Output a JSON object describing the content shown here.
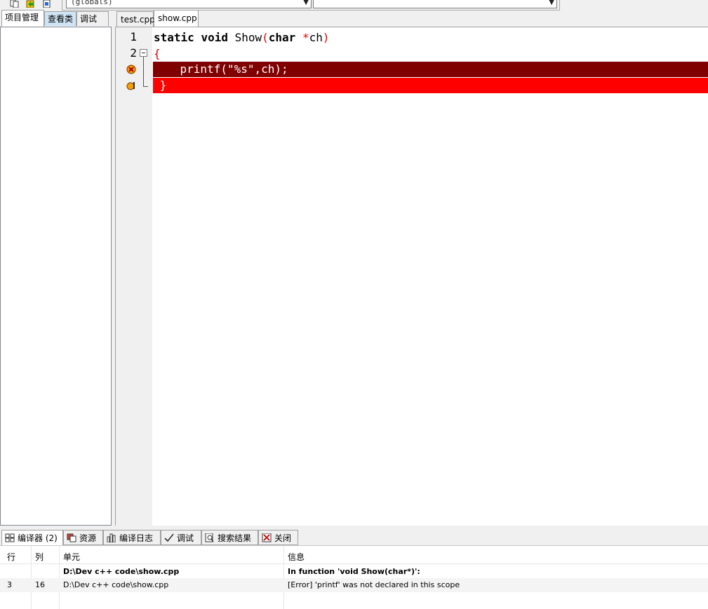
{
  "toolbar": {
    "scope_combo_value": "(globals)",
    "member_combo_value": ""
  },
  "left_panel": {
    "tabs": [
      {
        "label": "项目管理"
      },
      {
        "label": "查看类"
      },
      {
        "label": "调试"
      }
    ]
  },
  "editor": {
    "tabs": [
      {
        "label": "test.cpp"
      },
      {
        "label": "show.cpp"
      }
    ],
    "active_tab": "show.cpp",
    "lines": [
      {
        "number": "1",
        "text": "static void Show(char *ch)"
      },
      {
        "number": "2",
        "text": "{"
      },
      {
        "number": "",
        "text": "    printf(\"%s\",ch);"
      },
      {
        "number": "",
        "text": " }"
      }
    ],
    "colors": {
      "error_line_dark": "#800000",
      "error_line_bright": "#ff0000",
      "brace": "#e00000"
    }
  },
  "bottom_panel": {
    "tabs": [
      {
        "label": "编译器 (2)",
        "icon": "grid-icon"
      },
      {
        "label": "资源",
        "icon": "resources-icon"
      },
      {
        "label": "编译日志",
        "icon": "bar-chart-icon"
      },
      {
        "label": "调试",
        "icon": "checkmark-icon"
      },
      {
        "label": "搜索结果",
        "icon": "search-doc-icon"
      },
      {
        "label": "关闭",
        "icon": "close-icon"
      }
    ],
    "columns": {
      "line": "行",
      "col": "列",
      "unit": "单元",
      "message": "信息"
    },
    "rows": [
      {
        "line": "",
        "col": "",
        "unit": "D:\\Dev c++ code\\show.cpp",
        "message": "In function 'void Show(char*)':"
      },
      {
        "line": "3",
        "col": "16",
        "unit": "D:\\Dev c++ code\\show.cpp",
        "message": "[Error] 'printf' was not declared in this scope"
      }
    ]
  }
}
